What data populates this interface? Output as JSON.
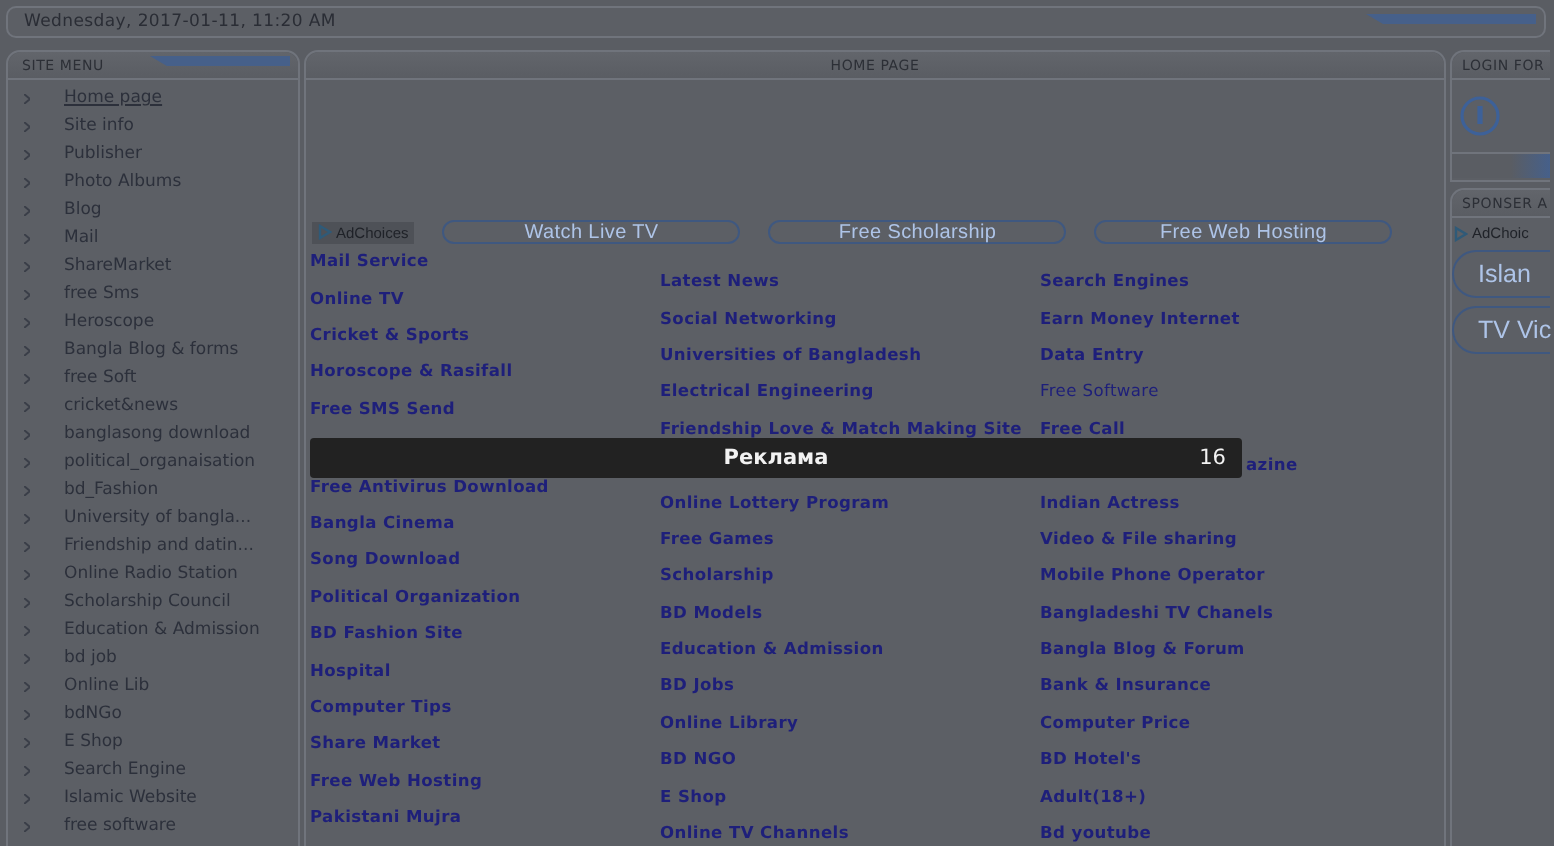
{
  "date": "Wednesday, 2017-01-11, 11:20 AM",
  "site_menu": {
    "title": "SITE MENU",
    "items": [
      {
        "label": "Home page",
        "selected": true
      },
      {
        "label": "Site info",
        "selected": false
      },
      {
        "label": "Publisher",
        "selected": false
      },
      {
        "label": "Photo Albums",
        "selected": false
      },
      {
        "label": "Blog",
        "selected": false
      },
      {
        "label": "Mail",
        "selected": false
      },
      {
        "label": "ShareMarket",
        "selected": false
      },
      {
        "label": "free Sms",
        "selected": false
      },
      {
        "label": "Heroscope",
        "selected": false
      },
      {
        "label": "Bangla Blog & forms",
        "selected": false
      },
      {
        "label": "free Soft",
        "selected": false
      },
      {
        "label": "cricket&news",
        "selected": false
      },
      {
        "label": "banglasong download",
        "selected": false
      },
      {
        "label": "political_organaisation",
        "selected": false
      },
      {
        "label": "bd_Fashion",
        "selected": false
      },
      {
        "label": "University of bangla...",
        "selected": false
      },
      {
        "label": "Friendship and datin...",
        "selected": false
      },
      {
        "label": "Online Radio Station",
        "selected": false
      },
      {
        "label": "Scholarship Council",
        "selected": false
      },
      {
        "label": "Education & Admission",
        "selected": false
      },
      {
        "label": "bd job",
        "selected": false
      },
      {
        "label": "Online Lib",
        "selected": false
      },
      {
        "label": "bdNGo",
        "selected": false
      },
      {
        "label": "E Shop",
        "selected": false
      },
      {
        "label": "Search Engine",
        "selected": false
      },
      {
        "label": "Islamic Website",
        "selected": false
      },
      {
        "label": "free software",
        "selected": false
      }
    ]
  },
  "home_page": {
    "title": "HOME PAGE",
    "adchoices": "AdChoices",
    "pill_links": [
      "Watch Live TV",
      "Free Scholarship",
      "Free Web Hosting"
    ],
    "columns": [
      [
        {
          "label": "Mail Service",
          "bold": true
        },
        {
          "label": "Online TV",
          "bold": true
        },
        {
          "label": "Cricket & Sports",
          "bold": true
        },
        {
          "label": "Horoscope & Rasifall",
          "bold": true
        },
        {
          "label": "Free SMS Send",
          "bold": true
        },
        {
          "label": "Free Antivirus Download",
          "bold": true
        },
        {
          "label": "Bangla Cinema",
          "bold": true
        },
        {
          "label": "Song Download",
          "bold": true
        },
        {
          "label": "Political Organization",
          "bold": true
        },
        {
          "label": "BD Fashion Site",
          "bold": true
        },
        {
          "label": "Hospital",
          "bold": true
        },
        {
          "label": "Computer Tips",
          "bold": true
        },
        {
          "label": "Share Market",
          "bold": true
        },
        {
          "label": "Free Web Hosting",
          "bold": true
        },
        {
          "label": "Pakistani Mujra",
          "bold": true
        }
      ],
      [
        {
          "label": "Latest News",
          "bold": true
        },
        {
          "label": "Social Networking",
          "bold": true
        },
        {
          "label": "Universities of Bangladesh",
          "bold": true
        },
        {
          "label": "Electrical Engineering",
          "bold": true
        },
        {
          "label": "Friendship Love & Match Making Site",
          "bold": true
        },
        {
          "label": "Online Lottery Program",
          "bold": true
        },
        {
          "label": "Free Games",
          "bold": true
        },
        {
          "label": "Scholarship",
          "bold": true
        },
        {
          "label": "BD Models",
          "bold": true
        },
        {
          "label": "Education & Admission",
          "bold": true
        },
        {
          "label": "BD Jobs",
          "bold": true
        },
        {
          "label": "Online Library",
          "bold": true
        },
        {
          "label": "BD NGO",
          "bold": true
        },
        {
          "label": "E Shop",
          "bold": true
        },
        {
          "label": "Online TV Channels",
          "bold": true
        }
      ],
      [
        {
          "label": "Search Engines",
          "bold": true
        },
        {
          "label": "Earn Money Internet",
          "bold": true
        },
        {
          "label": "Data Entry",
          "bold": true
        },
        {
          "label": "Free Software",
          "bold": false
        },
        {
          "label": "Free Call",
          "bold": true
        },
        {
          "label": "azine",
          "bold": true
        },
        {
          "label": "Indian Actress",
          "bold": true
        },
        {
          "label": "Video & File sharing",
          "bold": true
        },
        {
          "label": "Mobile Phone Operator",
          "bold": true
        },
        {
          "label": "Bangladeshi TV Chanels",
          "bold": true
        },
        {
          "label": "Bangla Blog & Forum",
          "bold": true
        },
        {
          "label": "Bank & Insurance",
          "bold": true
        },
        {
          "label": "Computer Price",
          "bold": true
        },
        {
          "label": "BD Hotel's",
          "bold": true
        },
        {
          "label": "Adult(18+)",
          "bold": true
        },
        {
          "label": "Bd youtube",
          "bold": true
        }
      ]
    ]
  },
  "login_form": {
    "title": "LOGIN FOR"
  },
  "sponsor_ads": {
    "title": "SPONSER A",
    "adchoices": "AdChoic",
    "buttons": [
      "Islan",
      "TV Vic"
    ]
  },
  "ad_bar": {
    "label": "Реклама",
    "countdown": "16"
  }
}
